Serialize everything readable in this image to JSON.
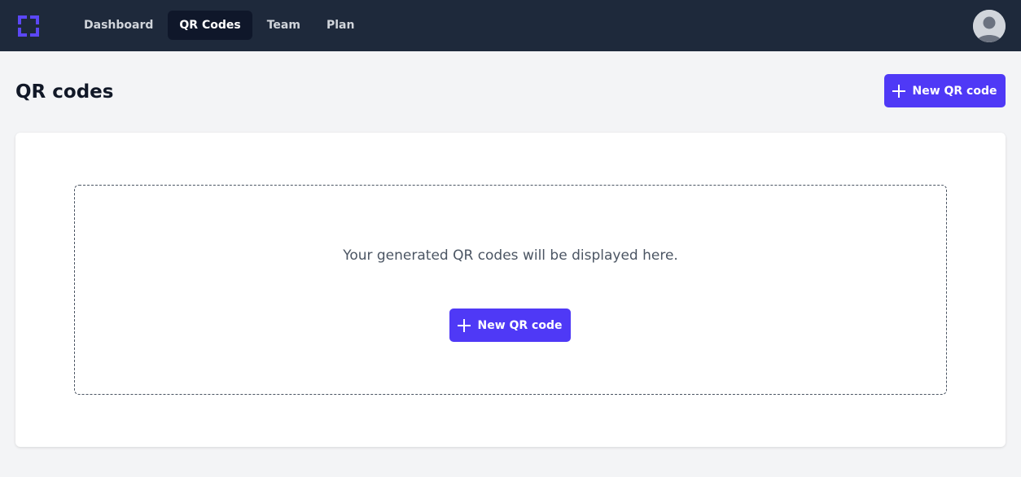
{
  "app": {
    "nav": [
      {
        "label": "Dashboard",
        "active": false
      },
      {
        "label": "QR Codes",
        "active": true
      },
      {
        "label": "Team",
        "active": false
      },
      {
        "label": "Plan",
        "active": false
      }
    ],
    "logo_icon": "qr-frame-logo",
    "avatar_icon": "user-avatar-icon"
  },
  "header": {
    "title": "QR codes",
    "new_button_label": "New QR code"
  },
  "empty_state": {
    "message": "Your generated QR codes will be displayed here.",
    "button_label": "New QR code"
  },
  "colors": {
    "topbar": "#1e293b",
    "accent": "#4f39f6",
    "page_bg": "#f3f4f6"
  }
}
